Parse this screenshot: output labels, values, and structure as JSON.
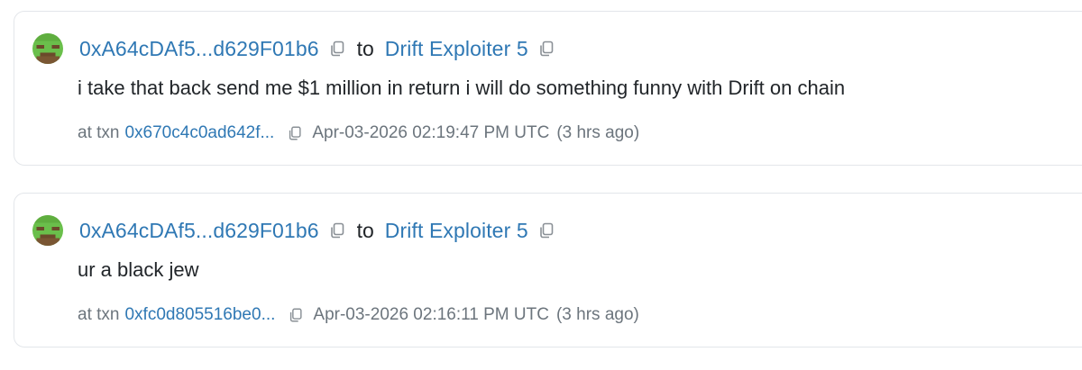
{
  "messages": [
    {
      "from_address": "0xA64cDAf5...d629F01b6",
      "to_word": "to",
      "to_name": "Drift Exploiter 5",
      "text": "i take that back send me $1 million in return i will do something funny with Drift on chain",
      "txn_prefix": "at txn",
      "txn_hash": "0x670c4c0ad642f...",
      "timestamp": "Apr-03-2026 02:19:47 PM UTC",
      "relative_time": "(3 hrs ago)"
    },
    {
      "from_address": "0xA64cDAf5...d629F01b6",
      "to_word": "to",
      "to_name": "Drift Exploiter 5",
      "text": "ur a black jew",
      "txn_prefix": "at txn",
      "txn_hash": "0xfc0d805516be0...",
      "timestamp": "Apr-03-2026 02:16:11 PM UTC",
      "relative_time": "(3 hrs ago)"
    }
  ],
  "icons": {
    "avatar": "pixel-avatar-icon",
    "copy": "copy-icon"
  },
  "colors": {
    "link": "#2f78b4",
    "muted": "#6c757d",
    "text": "#212529",
    "card_border": "#e3e6ea",
    "avatar_green": "#6abf4b",
    "avatar_brown": "#6b4a2b"
  }
}
